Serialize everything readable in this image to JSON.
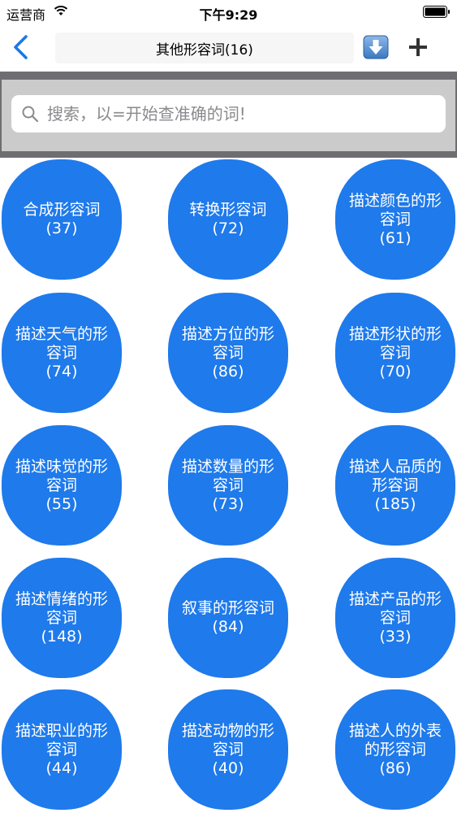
{
  "status_bar": {
    "carrier": "运营商",
    "time": "下午9:29"
  },
  "nav": {
    "title": "其他形容词(16)"
  },
  "search": {
    "placeholder": "搜索，以=开始查准确的词!"
  },
  "colors": {
    "accent": "#1f7aeb",
    "search_band": "#6e6e72",
    "search_inner": "#cbcbcb"
  },
  "categories": [
    {
      "name": "合成形容词",
      "count": "(37)"
    },
    {
      "name": "转换形容词",
      "count": "(72)"
    },
    {
      "name": "描述颜色的形容词",
      "count": "(61)"
    },
    {
      "name": "描述天气的形容词",
      "count": "(74)"
    },
    {
      "name": "描述方位的形容词",
      "count": "(86)"
    },
    {
      "name": "描述形状的形容词",
      "count": "(70)"
    },
    {
      "name": "描述味觉的形容词",
      "count": "(55)"
    },
    {
      "name": "描述数量的形容词",
      "count": "(73)"
    },
    {
      "name": "描述人品质的形容词",
      "count": "(185)"
    },
    {
      "name": "描述情绪的形容词",
      "count": "(148)"
    },
    {
      "name": "叙事的形容词",
      "count": "(84)"
    },
    {
      "name": "描述产品的形容词",
      "count": "(33)"
    },
    {
      "name": "描述职业的形容词",
      "count": "(44)"
    },
    {
      "name": "描述动物的形容词",
      "count": "(40)"
    },
    {
      "name": "描述人的外表的形容词",
      "count": "(86)"
    }
  ]
}
